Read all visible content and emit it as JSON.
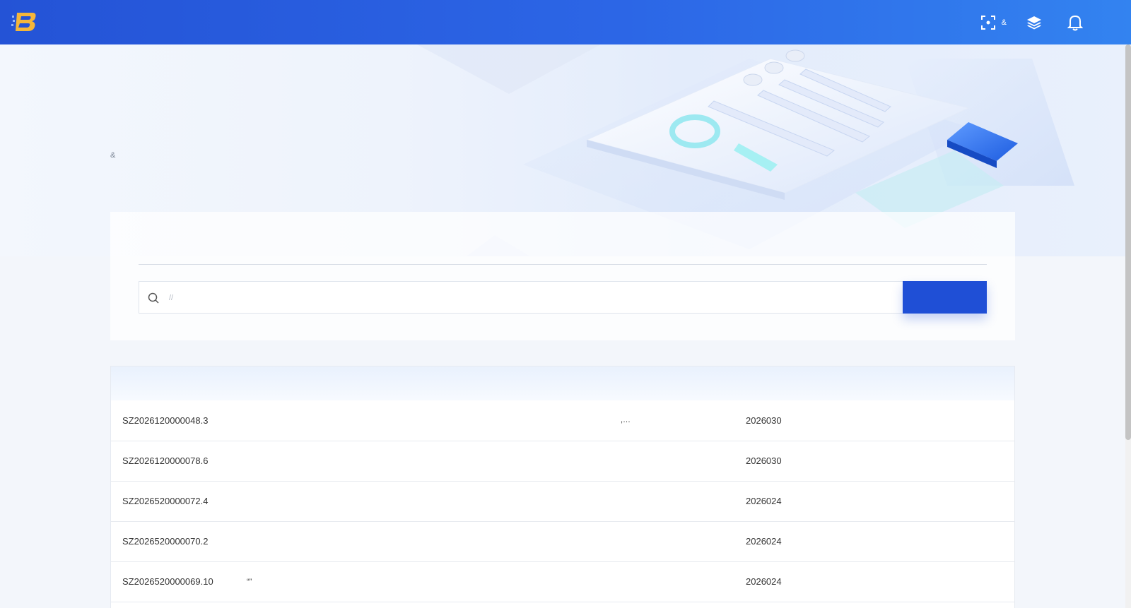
{
  "header": {
    "brand": "",
    "nav": [
      {
        "label": ""
      },
      {
        "label": ""
      }
    ],
    "actions": [
      {
        "label": "&",
        "icon": "scan-icon"
      },
      {
        "label": "",
        "icon": "layers-icon"
      }
    ],
    "bell_icon": "bell-icon",
    "login_label": ""
  },
  "hero": {
    "title": "",
    "subtitle": "&"
  },
  "search": {
    "tabs": [
      {
        "label": "",
        "active": true
      },
      {
        "label": "",
        "active": false
      }
    ],
    "placeholder": "//",
    "button_label": " "
  },
  "table": {
    "columns": [
      "",
      "",
      "",
      "",
      "",
      "",
      "",
      ""
    ],
    "rows": [
      {
        "code": "SZ2026120000048.3",
        "name": "",
        "col3": "",
        "col4": "",
        "col5": ",…",
        "date": "2026030",
        "view": "",
        "sub": ""
      },
      {
        "code": "SZ2026120000078.6",
        "name": "",
        "col3": "",
        "col4": "",
        "col5": "",
        "date": "2026030",
        "view": "",
        "sub": ""
      },
      {
        "code": "SZ2026520000072.4",
        "name": "",
        "col3": "",
        "col4": "",
        "col5": "",
        "date": "2026024",
        "view": "",
        "sub": ""
      },
      {
        "code": "SZ2026520000070.2",
        "name": "",
        "col3": "",
        "col4": "",
        "col5": "",
        "date": "2026024",
        "view": "",
        "sub": ""
      },
      {
        "code": "SZ2026520000069.10",
        "name": "“”",
        "col3": "",
        "col4": "",
        "col5": "",
        "date": "2026024",
        "view": "",
        "sub": ""
      }
    ]
  },
  "colors": {
    "primary": "#2453d6",
    "view_link": "#1aa05a",
    "subscribe_link": "#e0322d"
  }
}
